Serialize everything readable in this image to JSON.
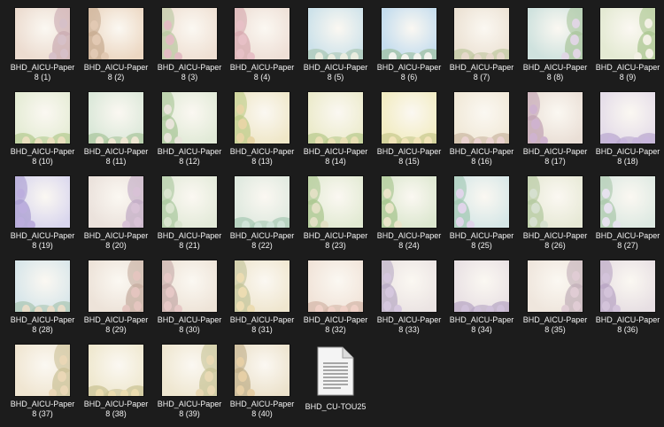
{
  "files": [
    {
      "label": "BHD_AICU-Paper 8 (1)",
      "bg": "#ecdcd0",
      "accent": "#c9a9b0",
      "egg": "#d6c0c8",
      "side": "right"
    },
    {
      "label": "BHD_AICU-Paper 8 (2)",
      "bg": "#ecd7c2",
      "accent": "#c6aa8f",
      "egg": "#e2c9b3",
      "side": "left"
    },
    {
      "label": "BHD_AICU-Paper 8 (3)",
      "bg": "#efe0d3",
      "accent": "#b8c7a0",
      "egg": "#e2bcc2",
      "side": "left"
    },
    {
      "label": "BHD_AICU-Paper 8 (4)",
      "bg": "#eedfd6",
      "accent": "#d5a7ae",
      "egg": "#e7c0c6",
      "side": "left"
    },
    {
      "label": "BHD_AICU-Paper 8 (5)",
      "bg": "#cde2ea",
      "accent": "#aac8b4",
      "egg": "#e9ecdf",
      "side": "bottom"
    },
    {
      "label": "BHD_AICU-Paper 8 (6)",
      "bg": "#c3dcee",
      "accent": "#9dbf9e",
      "egg": "#f1f2ec",
      "side": "bottom"
    },
    {
      "label": "BHD_AICU-Paper 8 (7)",
      "bg": "#ece2d4",
      "accent": "#bfc79e",
      "egg": "#e6d8cb",
      "side": "bottom"
    },
    {
      "label": "BHD_AICU-Paper 8 (8)",
      "bg": "#cfe2de",
      "accent": "#a9c49b",
      "egg": "#e0d6e4",
      "side": "right"
    },
    {
      "label": "BHD_AICU-Paper 8 (9)",
      "bg": "#e4ead3",
      "accent": "#a8c48e",
      "egg": "#f2f0e4",
      "side": "right"
    },
    {
      "label": "BHD_AICU-Paper 8 (10)",
      "bg": "#e5ecd5",
      "accent": "#b3cb8f",
      "egg": "#eadfbe",
      "side": "bottom"
    },
    {
      "label": "BHD_AICU-Paper 8 (11)",
      "bg": "#dbe8d9",
      "accent": "#a8c49a",
      "egg": "#eee6d2",
      "side": "bottom"
    },
    {
      "label": "BHD_AICU-Paper 8 (12)",
      "bg": "#e1ead7",
      "accent": "#a7c495",
      "egg": "#e8e4da",
      "side": "left"
    },
    {
      "label": "BHD_AICU-Paper 8 (13)",
      "bg": "#efe7c8",
      "accent": "#bccb86",
      "egg": "#e7d5a6",
      "side": "left"
    },
    {
      "label": "BHD_AICU-Paper 8 (14)",
      "bg": "#ecebcc",
      "accent": "#b7c98a",
      "egg": "#e9dfb4",
      "side": "bottom"
    },
    {
      "label": "BHD_AICU-Paper 8 (15)",
      "bg": "#f2ecc2",
      "accent": "#c7c98d",
      "egg": "#f1e3b8",
      "side": "bottom"
    },
    {
      "label": "BHD_AICU-Paper 8 (16)",
      "bg": "#f1e9d8",
      "accent": "#cbb7a1",
      "egg": "#ead2d0",
      "side": "bottom"
    },
    {
      "label": "BHD_AICU-Paper 8 (17)",
      "bg": "#eadfd6",
      "accent": "#c1a1b4",
      "egg": "#cfb3cf",
      "side": "left"
    },
    {
      "label": "BHD_AICU-Paper 8 (18)",
      "bg": "#e5dde9",
      "accent": "#b9a7cf",
      "egg": "#c8b6dc",
      "side": "bottom"
    },
    {
      "label": "BHD_AICU-Paper 8 (19)",
      "bg": "#d9d6ee",
      "accent": "#a89bd0",
      "egg": "#bcaede",
      "side": "left"
    },
    {
      "label": "BHD_AICU-Paper 8 (20)",
      "bg": "#ebe2dc",
      "accent": "#c0a9c4",
      "egg": "#d8c2d6",
      "side": "right"
    },
    {
      "label": "BHD_AICU-Paper 8 (21)",
      "bg": "#e3ead9",
      "accent": "#a8c79d",
      "egg": "#d9e4ce",
      "side": "left"
    },
    {
      "label": "BHD_AICU-Paper 8 (22)",
      "bg": "#dfe9df",
      "accent": "#a6c9b4",
      "egg": "#cfe3d8",
      "side": "bottom"
    },
    {
      "label": "BHD_AICU-Paper 8 (23)",
      "bg": "#e2ead3",
      "accent": "#a8c48c",
      "egg": "#e2e0c4",
      "side": "left"
    },
    {
      "label": "BHD_AICU-Paper 8 (24)",
      "bg": "#dce7cf",
      "accent": "#a4c38b",
      "egg": "#e9e4c9",
      "side": "left"
    },
    {
      "label": "BHD_AICU-Paper 8 (25)",
      "bg": "#d6e7e7",
      "accent": "#9fc6b1",
      "egg": "#e0d5ea",
      "side": "left"
    },
    {
      "label": "BHD_AICU-Paper 8 (26)",
      "bg": "#e7e9d6",
      "accent": "#b0c79c",
      "egg": "#d6e0cf",
      "side": "left"
    },
    {
      "label": "BHD_AICU-Paper 8 (27)",
      "bg": "#dde9e2",
      "accent": "#a9c7aa",
      "egg": "#e6e2ee",
      "side": "left"
    },
    {
      "label": "BHD_AICU-Paper 8 (28)",
      "bg": "#d8e6ea",
      "accent": "#a9c4b0",
      "egg": "#e7dcc8",
      "side": "bottom"
    },
    {
      "label": "BHD_AICU-Paper 8 (29)",
      "bg": "#ede3d9",
      "accent": "#c5ab9e",
      "egg": "#e4c5bf",
      "side": "right"
    },
    {
      "label": "BHD_AICU-Paper 8 (30)",
      "bg": "#eee4d8",
      "accent": "#c4a8a7",
      "egg": "#e6c8c6",
      "side": "left"
    },
    {
      "label": "BHD_AICU-Paper 8 (31)",
      "bg": "#efe6cf",
      "accent": "#c2c397",
      "egg": "#ecdcb2",
      "side": "left"
    },
    {
      "label": "BHD_AICU-Paper 8 (32)",
      "bg": "#f1e4d9",
      "accent": "#d3b5a6",
      "egg": "#efd0c6",
      "side": "bottom"
    },
    {
      "label": "BHD_AICU-Paper 8 (33)",
      "bg": "#ebe4e3",
      "accent": "#b8aac5",
      "egg": "#d5c7de",
      "side": "left"
    },
    {
      "label": "BHD_AICU-Paper 8 (34)",
      "bg": "#e9e1e4",
      "accent": "#b6a5c3",
      "egg": "#cfc0d9",
      "side": "bottom"
    },
    {
      "label": "BHD_AICU-Paper 8 (35)",
      "bg": "#efe6dd",
      "accent": "#c1aeb8",
      "egg": "#e0ccd4",
      "side": "right"
    },
    {
      "label": "BHD_AICU-Paper 8 (36)",
      "bg": "#e7dfe3",
      "accent": "#b7a3c3",
      "egg": "#d3c3da",
      "side": "left"
    },
    {
      "label": "BHD_AICU-Paper 8 (37)",
      "bg": "#f0e6d2",
      "accent": "#cbc096",
      "egg": "#ead7b6",
      "side": "right"
    },
    {
      "label": "BHD_AICU-Paper 8 (38)",
      "bg": "#efe8cf",
      "accent": "#c9c292",
      "egg": "#ebdcaf",
      "side": "bottom"
    },
    {
      "label": "BHD_AICU-Paper 8 (39)",
      "bg": "#efe7d1",
      "accent": "#c7c396",
      "egg": "#e9d9b4",
      "side": "right"
    },
    {
      "label": "BHD_AICU-Paper 8 (40)",
      "bg": "#ece2cc",
      "accent": "#bfae87",
      "egg": "#e6cfa6",
      "side": "left"
    }
  ],
  "document": {
    "label": "BHD_CU-TOU25",
    "icon": "text-document-icon"
  },
  "colors": {
    "background": "#1c1c1c",
    "text": "#f2f2f2"
  }
}
